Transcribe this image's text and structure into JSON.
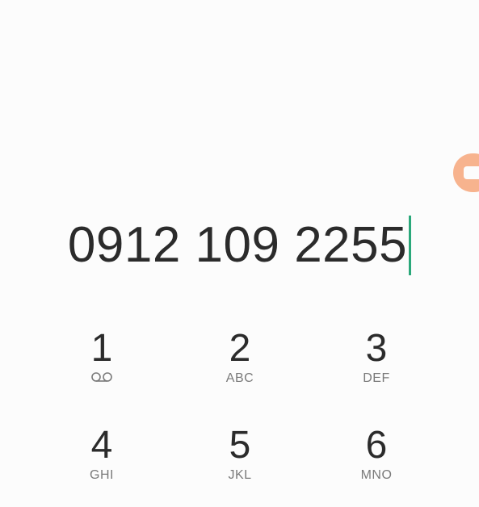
{
  "dialer": {
    "number": "0912 109 2255",
    "accent_color": "#2aa87a",
    "edge_handle_color": "#f7b38e"
  },
  "keypad": [
    {
      "digit": "1",
      "letters": "",
      "icon": "voicemail-icon"
    },
    {
      "digit": "2",
      "letters": "ABC"
    },
    {
      "digit": "3",
      "letters": "DEF"
    },
    {
      "digit": "4",
      "letters": "GHI"
    },
    {
      "digit": "5",
      "letters": "JKL"
    },
    {
      "digit": "6",
      "letters": "MNO"
    }
  ]
}
